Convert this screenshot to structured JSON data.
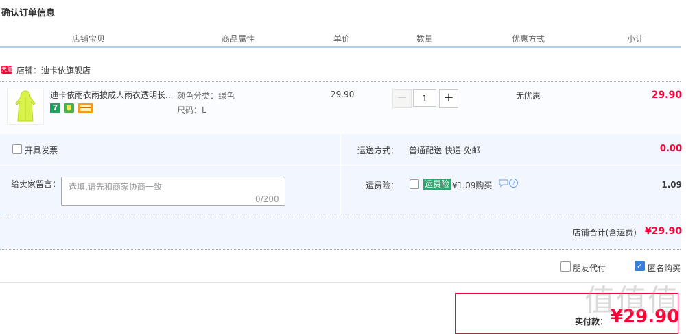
{
  "page_title": "确认订单信息",
  "columns": [
    "店铺宝贝",
    "商品属性",
    "单价",
    "数量",
    "优惠方式",
    "小计"
  ],
  "shop": {
    "badge": "天猫",
    "label": "店铺：迪卡依旗舰店"
  },
  "item": {
    "title": "迪卡依雨衣雨披成人雨衣透明长...",
    "service_icons": [
      "7-day-return-icon",
      "guarantee-icon",
      "card-pay-icon"
    ],
    "service_seven": "7",
    "props": [
      "颜色分类：绿色",
      "尺码：L"
    ],
    "price": "29.90",
    "qty": "1",
    "qty_minus": "−",
    "qty_plus": "+",
    "promo": "无优惠",
    "subtotal": "29.90"
  },
  "invoice": {
    "label": "开具发票"
  },
  "shipping": {
    "label": "运送方式：",
    "value": "普通配送 快递 免邮",
    "price": "0.00"
  },
  "message": {
    "label": "给卖家留言：",
    "placeholder": "选填,请先和商家协商一致",
    "count": "0/200"
  },
  "insurance": {
    "label": "运费险：",
    "badge": "运费险",
    "price_text": "¥1.09购买",
    "value": "1.09"
  },
  "shop_total": {
    "label": "店铺合计(含运费)",
    "value": "¥29.90"
  },
  "options": {
    "friend_pay": "朋友代付",
    "anonymous": "匿名购买"
  },
  "payment": {
    "label": "实付款：",
    "amount": "¥29.90"
  },
  "watermark": "值值值",
  "colors": {
    "accent_red": "#ff0036",
    "header_border": "#b2d1ff",
    "panel_bg": "#f2f7ff",
    "check_blue": "#3a7fe0"
  }
}
